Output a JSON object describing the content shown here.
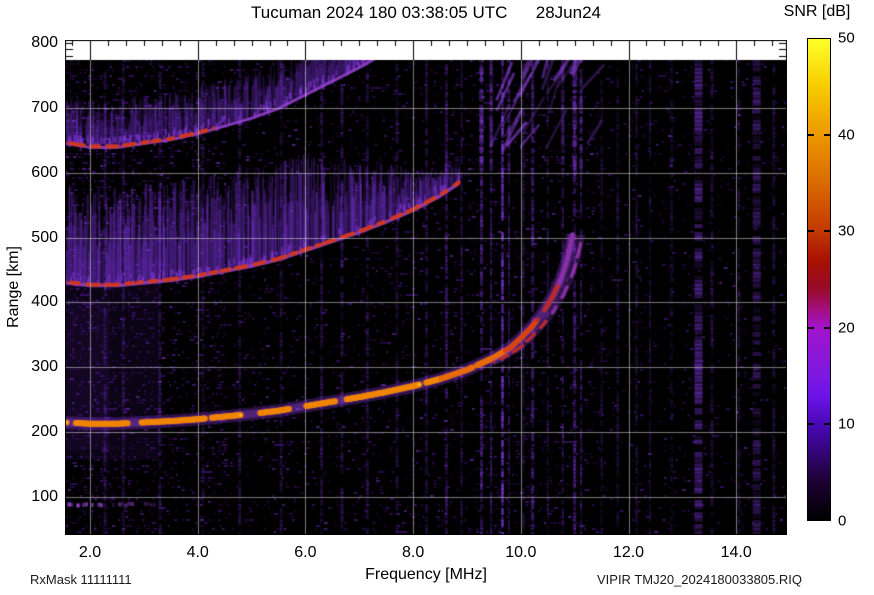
{
  "title": "Tucuman 2024 180 03:38:05 UTC      28Jun24",
  "colorbar": {
    "label": "SNR [dB]",
    "tick_labels": [
      "50",
      "40",
      "30",
      "20",
      "10",
      "0"
    ],
    "tick_values": [
      50,
      40,
      30,
      20,
      10,
      0
    ],
    "min": 0,
    "max": 50,
    "stops": [
      [
        0.0,
        "#000000"
      ],
      [
        0.08,
        "#1c0133"
      ],
      [
        0.2,
        "#4a08b8"
      ],
      [
        0.26,
        "#6d14e8"
      ],
      [
        0.3,
        "#7d18e0"
      ],
      [
        0.4,
        "#a214cc"
      ],
      [
        0.44,
        "#a30f7a"
      ],
      [
        0.48,
        "#970b2a"
      ],
      [
        0.54,
        "#a81000"
      ],
      [
        0.6,
        "#c23800"
      ],
      [
        0.7,
        "#da6a00"
      ],
      [
        0.8,
        "#ec9800"
      ],
      [
        0.9,
        "#f8cb00"
      ],
      [
        1.0,
        "#ffff2a"
      ]
    ]
  },
  "axes": {
    "x_label": "Frequency [MHz]",
    "y_label": "Range [km]",
    "x_tick_labels": [
      "2.0",
      "4.0",
      "6.0",
      "8.0",
      "10.0",
      "12.0",
      "14.0"
    ],
    "y_tick_labels": [
      "800",
      "700",
      "600",
      "500",
      "400",
      "300",
      "200",
      "100"
    ]
  },
  "footer": {
    "left": "RxMask 11111111",
    "right": "VIPIR  TMJ20_2024180033805.RIQ"
  },
  "chart_data": {
    "type": "heatmap",
    "title": "Tucuman 2024 180 03:38:05 UTC 28Jun24",
    "station": "Tucuman",
    "year": "2024",
    "day_of_year": "180",
    "time_utc": "03:38:05",
    "date": "28Jun24",
    "xlabel": "Frequency [MHz]",
    "ylabel": "Range [km]",
    "zlabel": "SNR [dB]",
    "xlim": [
      1.54,
      14.94
    ],
    "ylim": [
      40,
      808
    ],
    "zlim": [
      0,
      50
    ],
    "x_ticks": [
      2,
      4,
      6,
      8,
      10,
      12,
      14
    ],
    "y_ticks": [
      100,
      200,
      300,
      400,
      500,
      600,
      700,
      800
    ],
    "grid": true,
    "legend_position": "right-colorbar",
    "f2_trace": {
      "freq_mhz": [
        1.55,
        2.0,
        2.5,
        3.0,
        3.5,
        4.0,
        4.5,
        5.0,
        5.5,
        6.0,
        6.5,
        7.0,
        7.5,
        8.0,
        8.5,
        9.0,
        9.5,
        9.8,
        10.0,
        10.2,
        10.4,
        10.6,
        10.75,
        10.85,
        10.92,
        10.96
      ],
      "virtual_height_km": [
        215,
        213,
        213,
        215,
        217,
        220,
        224,
        228,
        233,
        240,
        247,
        254,
        262,
        271,
        282,
        296,
        315,
        330,
        345,
        362,
        383,
        410,
        437,
        462,
        487,
        505
      ]
    },
    "critical_freq_mhz": 10.96,
    "min_freq_mhz": 1.545,
    "x_mode_offset_mhz": 0.18,
    "x_mode_from_mhz": 9.3,
    "multiples": [
      {
        "hop": 2,
        "max_freq_mhz": 8.85,
        "base_height_km": 430
      },
      {
        "hop": 3,
        "max_freq_mhz": 8.6,
        "base_height_km": 645
      }
    ],
    "sporadic_e": {
      "height_km": 90,
      "segments_mhz": [
        [
          1.58,
          2.2,
          0.85
        ],
        [
          2.3,
          2.8,
          0.5
        ],
        [
          3.0,
          3.35,
          0.3
        ]
      ]
    },
    "spread_f_region": {
      "freq_mhz": [
        9.35,
        11.25
      ],
      "height_km": [
        610,
        770
      ]
    },
    "rfi_stripes": [
      [
        2.28,
        0.3,
        3,
        0
      ],
      [
        2.62,
        0.22,
        3,
        0
      ],
      [
        3.3,
        0.25,
        3,
        0
      ],
      [
        4.1,
        0.2,
        3,
        0
      ],
      [
        4.78,
        0.25,
        3,
        0
      ],
      [
        5.55,
        0.22,
        3,
        0
      ],
      [
        6.3,
        0.25,
        3,
        0
      ],
      [
        6.68,
        0.3,
        3,
        0
      ],
      [
        7.15,
        0.25,
        3,
        0
      ],
      [
        7.7,
        0.22,
        3,
        0
      ],
      [
        8.25,
        0.25,
        3,
        0
      ],
      [
        8.62,
        0.35,
        3,
        0
      ],
      [
        8.9,
        0.3,
        2,
        0
      ],
      [
        9.27,
        0.5,
        3,
        1
      ],
      [
        9.45,
        0.4,
        2,
        1
      ],
      [
        9.66,
        0.9,
        2.5,
        0
      ],
      [
        9.78,
        0.35,
        2,
        1
      ],
      [
        10.05,
        0.3,
        2,
        0
      ],
      [
        10.22,
        0.45,
        3,
        0
      ],
      [
        10.5,
        0.3,
        2,
        0
      ],
      [
        10.78,
        0.35,
        2,
        1
      ],
      [
        11.0,
        0.45,
        3,
        1
      ],
      [
        11.12,
        0.4,
        2,
        1
      ],
      [
        11.5,
        0.25,
        2,
        0
      ],
      [
        11.8,
        0.2,
        3,
        0
      ],
      [
        12.15,
        0.3,
        2,
        0
      ],
      [
        12.4,
        0.25,
        2,
        0
      ],
      [
        12.8,
        0.2,
        3,
        0
      ],
      [
        13.3,
        0.45,
        8,
        0
      ],
      [
        13.55,
        0.25,
        3,
        0
      ],
      [
        14.05,
        0.2,
        3,
        0
      ],
      [
        14.38,
        0.35,
        8,
        0
      ],
      [
        14.7,
        0.25,
        3,
        0
      ]
    ],
    "palette": {
      "background": "#000000",
      "noise_dim": "#32084f",
      "noise_mid": "#5a18b0",
      "noise_bright": "#8a3ae0",
      "glow": "#9b4ce8",
      "cloud": "#7a35d8",
      "edge_red": "#cc3a2a",
      "trace_orange": "#f08500",
      "trace_hot": "#ffcf30",
      "trace_red": "#d84414",
      "trace_crimson": "#bb2a30",
      "trace_purple": "#8d2fa8",
      "grid": "#c9c9c9"
    }
  }
}
